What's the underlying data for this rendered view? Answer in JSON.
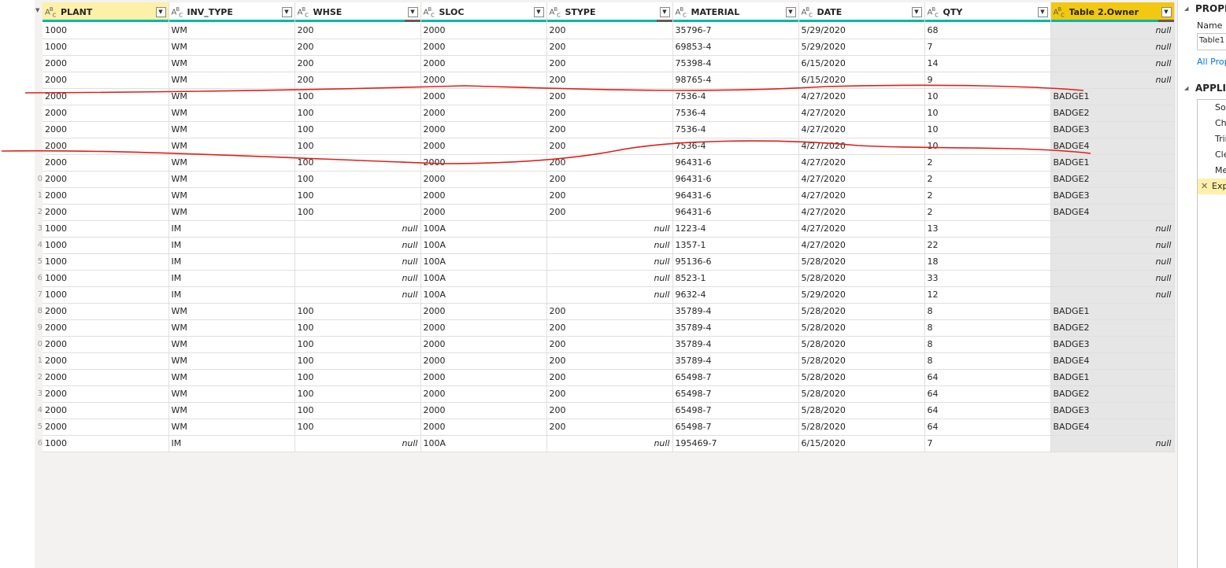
{
  "columns": [
    {
      "name": "PLANT",
      "type_icon": "ABC"
    },
    {
      "name": "INV_TYPE",
      "type_icon": "ABC"
    },
    {
      "name": "WHSE",
      "type_icon": "ABC"
    },
    {
      "name": "SLOC",
      "type_icon": "ABC"
    },
    {
      "name": "STYPE",
      "type_icon": "ABC"
    },
    {
      "name": "MATERIAL",
      "type_icon": "ABC"
    },
    {
      "name": "DATE",
      "type_icon": "ABC"
    },
    {
      "name": "QTY",
      "type_icon": "ABC"
    },
    {
      "name": "Table 2.Owner",
      "type_icon": "ABC"
    }
  ],
  "null_label": "null",
  "row_numbers": [
    "",
    "",
    "",
    "",
    "",
    "",
    "",
    "",
    "",
    "0",
    "1",
    "2",
    "3",
    "4",
    "5",
    "6",
    "7",
    "8",
    "9",
    "0",
    "1",
    "2",
    "3",
    "4",
    "5",
    "6"
  ],
  "rows": [
    [
      "1000",
      "WM",
      "200",
      "2000",
      "200",
      "35796-7",
      "5/29/2020",
      "68",
      null
    ],
    [
      "1000",
      "WM",
      "200",
      "2000",
      "200",
      "69853-4",
      "5/29/2020",
      "7",
      null
    ],
    [
      "2000",
      "WM",
      "200",
      "2000",
      "200",
      "75398-4",
      "6/15/2020",
      "14",
      null
    ],
    [
      "2000",
      "WM",
      "200",
      "2000",
      "200",
      "98765-4",
      "6/15/2020",
      "9",
      null
    ],
    [
      "2000",
      "WM",
      "100",
      "2000",
      "200",
      "7536-4",
      "4/27/2020",
      "10",
      "BADGE1"
    ],
    [
      "2000",
      "WM",
      "100",
      "2000",
      "200",
      "7536-4",
      "4/27/2020",
      "10",
      "BADGE2"
    ],
    [
      "2000",
      "WM",
      "100",
      "2000",
      "200",
      "7536-4",
      "4/27/2020",
      "10",
      "BADGE3"
    ],
    [
      "2000",
      "WM",
      "100",
      "2000",
      "200",
      "7536-4",
      "4/27/2020",
      "10",
      "BADGE4"
    ],
    [
      "2000",
      "WM",
      "100",
      "2000",
      "200",
      "96431-6",
      "4/27/2020",
      "2",
      "BADGE1"
    ],
    [
      "2000",
      "WM",
      "100",
      "2000",
      "200",
      "96431-6",
      "4/27/2020",
      "2",
      "BADGE2"
    ],
    [
      "2000",
      "WM",
      "100",
      "2000",
      "200",
      "96431-6",
      "4/27/2020",
      "2",
      "BADGE3"
    ],
    [
      "2000",
      "WM",
      "100",
      "2000",
      "200",
      "96431-6",
      "4/27/2020",
      "2",
      "BADGE4"
    ],
    [
      "1000",
      "IM",
      null,
      "100A",
      null,
      "1223-4",
      "4/27/2020",
      "13",
      null
    ],
    [
      "1000",
      "IM",
      null,
      "100A",
      null,
      "1357-1",
      "4/27/2020",
      "22",
      null
    ],
    [
      "1000",
      "IM",
      null,
      "100A",
      null,
      "95136-6",
      "5/28/2020",
      "18",
      null
    ],
    [
      "1000",
      "IM",
      null,
      "100A",
      null,
      "8523-1",
      "5/28/2020",
      "33",
      null
    ],
    [
      "1000",
      "IM",
      null,
      "100A",
      null,
      "9632-4",
      "5/29/2020",
      "12",
      null
    ],
    [
      "2000",
      "WM",
      "100",
      "2000",
      "200",
      "35789-4",
      "5/28/2020",
      "8",
      "BADGE1"
    ],
    [
      "2000",
      "WM",
      "100",
      "2000",
      "200",
      "35789-4",
      "5/28/2020",
      "8",
      "BADGE2"
    ],
    [
      "2000",
      "WM",
      "100",
      "2000",
      "200",
      "35789-4",
      "5/28/2020",
      "8",
      "BADGE3"
    ],
    [
      "2000",
      "WM",
      "100",
      "2000",
      "200",
      "35789-4",
      "5/28/2020",
      "8",
      "BADGE4"
    ],
    [
      "2000",
      "WM",
      "100",
      "2000",
      "200",
      "65498-7",
      "5/28/2020",
      "64",
      "BADGE1"
    ],
    [
      "2000",
      "WM",
      "100",
      "2000",
      "200",
      "65498-7",
      "5/28/2020",
      "64",
      "BADGE2"
    ],
    [
      "2000",
      "WM",
      "100",
      "2000",
      "200",
      "65498-7",
      "5/28/2020",
      "64",
      "BADGE3"
    ],
    [
      "2000",
      "WM",
      "100",
      "2000",
      "200",
      "65498-7",
      "5/28/2020",
      "64",
      "BADGE4"
    ],
    [
      "1000",
      "IM",
      null,
      "100A",
      null,
      "195469-7",
      "6/15/2020",
      "7",
      null
    ]
  ],
  "right_pane": {
    "properties_heading": "PROPE",
    "name_label": "Name",
    "name_value": "Table1",
    "all_properties_link": "All Prop",
    "applied_steps_heading": "APPLIE",
    "steps": [
      {
        "label": "Sou",
        "active": false
      },
      {
        "label": "Cha",
        "active": false
      },
      {
        "label": "Trir",
        "active": false
      },
      {
        "label": "Cle",
        "active": false
      },
      {
        "label": "Me",
        "active": false
      },
      {
        "label": "Exp",
        "active": true
      }
    ]
  },
  "colors": {
    "selected_header": "#f2c811",
    "first_header": "#fdf0a8",
    "quality_bar": "#01b8aa",
    "annotation_stroke": "#e0201b",
    "link": "#0078d4"
  },
  "icons": {
    "type_icon": "abc-text-type-icon",
    "dropdown": "chevron-down-icon",
    "step_delete": "close-icon",
    "collapse": "triangle-collapse-icon"
  }
}
